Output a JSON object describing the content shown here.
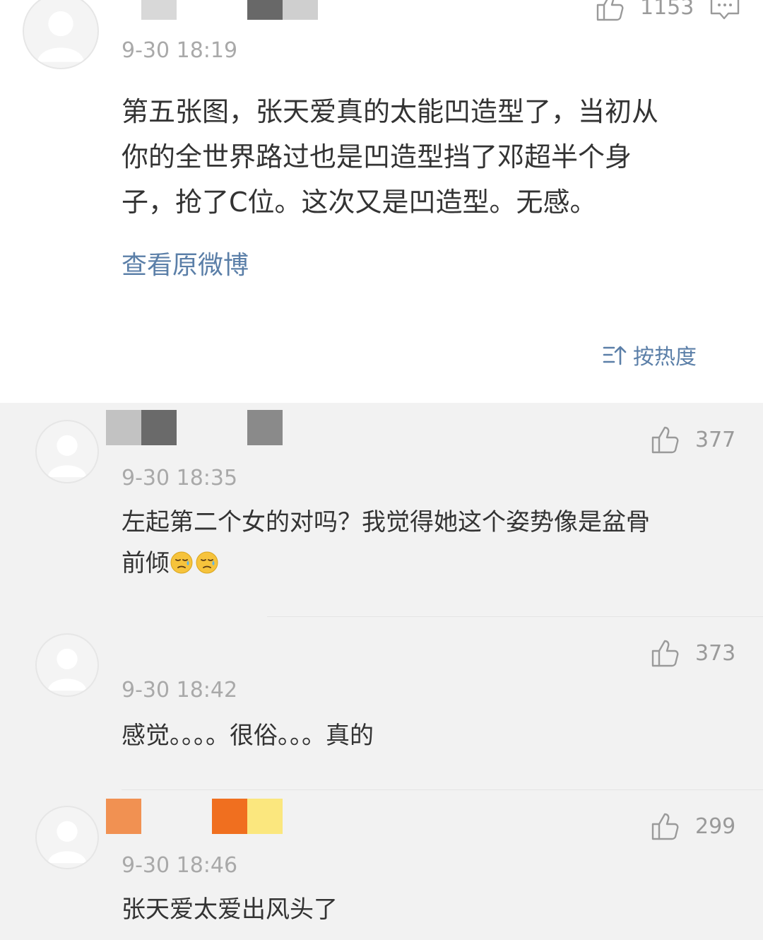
{
  "main_post": {
    "likes": "1153",
    "time": "9-30 18:19",
    "lines": [
      "第五张图，张天爱真的太能凹造型了，当初从",
      "你的全世界路过也是凹造型挡了邓超半个身",
      "子，抢了C位。这次又是凹造型。无感。"
    ],
    "view_original": "查看原微博"
  },
  "sort": {
    "label": "按热度"
  },
  "comments": [
    {
      "likes": "377",
      "time": "9-30 18:35",
      "lines": [
        "左起第二个女的对吗？我觉得她这个姿势像是盆骨",
        "前倾"
      ],
      "emoji": [
        "sweat-face-icon",
        "sweat-face-icon"
      ]
    },
    {
      "likes": "373",
      "time": "9-30 18:42",
      "lines": [
        "感觉。。。。很俗。。。真的"
      ]
    },
    {
      "likes": "299",
      "time": "9-30 18:46",
      "lines": [
        "张天爱太爱出风头了"
      ]
    }
  ],
  "colors": {
    "link": "#5b7fa8",
    "text": "#333333",
    "meta": "#a9a9a9",
    "background_comments": "#f2f2f2",
    "background_post": "#ffffff"
  }
}
